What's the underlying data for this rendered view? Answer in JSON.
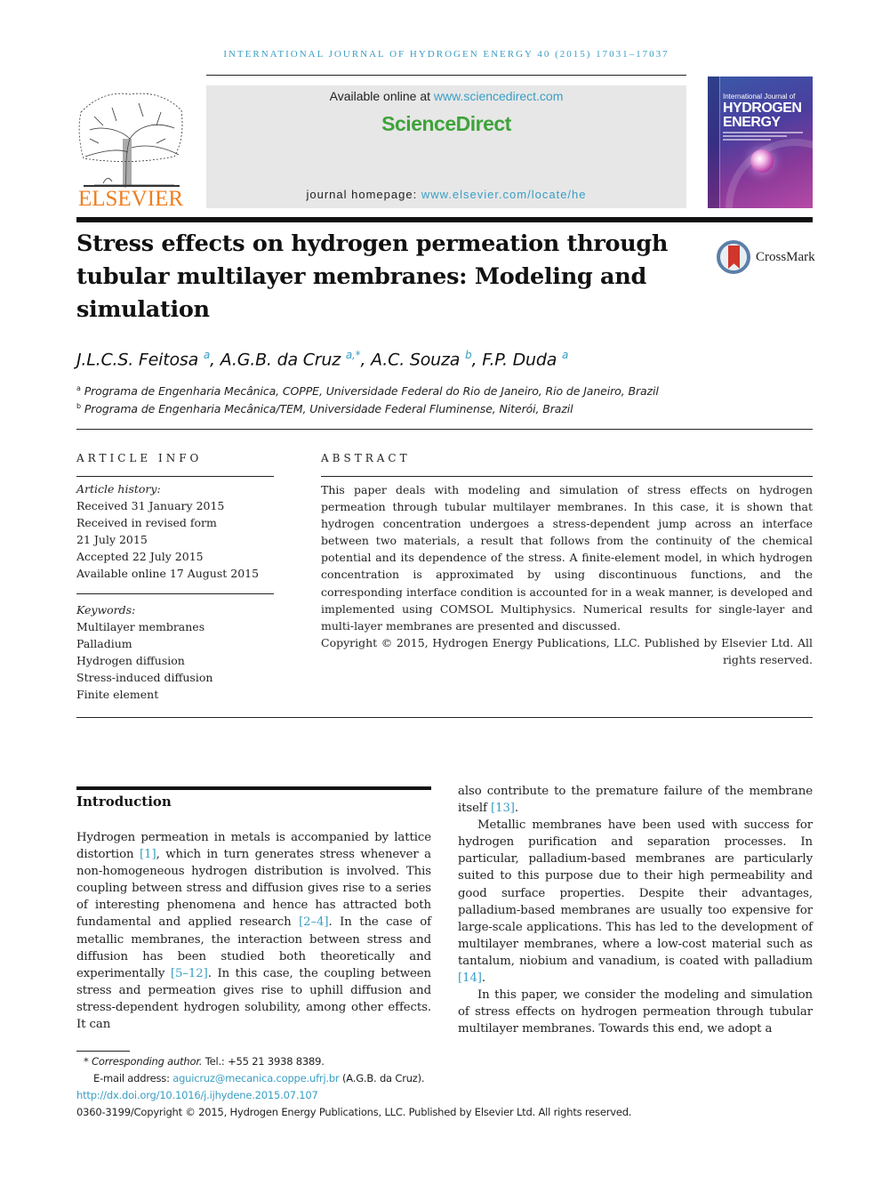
{
  "running_head": "INTERNATIONAL JOURNAL OF HYDROGEN ENERGY 40 (2015) 17031–17037",
  "publisher": {
    "logo_text": "ELSEVIER",
    "available_prefix": "Available online at ",
    "available_link": "www.sciencedirect.com",
    "brand": "ScienceDirect",
    "homepage_prefix": "journal homepage: ",
    "homepage_link": "www.elsevier.com/locate/he"
  },
  "cover": {
    "subtitle": "International Journal of",
    "title_line1": "HYDROGEN",
    "title_line2": "ENERGY"
  },
  "crossmark_label": "CrossMark",
  "title": "Stress effects on hydrogen permeation through tubular multilayer membranes: Modeling and simulation",
  "authors": [
    {
      "name": "J.L.C.S. Feitosa",
      "sup": "a"
    },
    {
      "name": "A.G.B. da Cruz",
      "sup": "a,*"
    },
    {
      "name": "A.C. Souza",
      "sup": "b"
    },
    {
      "name": "F.P. Duda",
      "sup": "a"
    }
  ],
  "affiliations": [
    {
      "mark": "a",
      "text": "Programa de Engenharia Mecânica, COPPE, Universidade Federal do Rio de Janeiro, Rio de Janeiro, Brazil"
    },
    {
      "mark": "b",
      "text": "Programa de Engenharia Mecânica/TEM, Universidade Federal Fluminense, Niterói, Brazil"
    }
  ],
  "article_info": {
    "heading": "ARTICLE INFO",
    "history_label": "Article history:",
    "history": [
      "Received 31 January 2015",
      "Received in revised form",
      "21 July 2015",
      "Accepted 22 July 2015",
      "Available online 17 August 2015"
    ],
    "keywords_label": "Keywords:",
    "keywords": [
      "Multilayer membranes",
      "Palladium",
      "Hydrogen diffusion",
      "Stress-induced diffusion",
      "Finite element"
    ]
  },
  "abstract": {
    "heading": "ABSTRACT",
    "text": "This paper deals with modeling and simulation of stress effects on hydrogen permeation through tubular multilayer membranes. In this case, it is shown that hydrogen concentration undergoes a stress-dependent jump across an interface between two materials, a result that follows from the continuity of the chemical potential and its dependence of the stress. A finite-element model, in which hydrogen concentration is approximated by using discontinuous functions, and the corresponding interface condition is accounted for in a weak manner, is developed and implemented using COMSOL Multiphysics. Numerical results for single-layer and multi-layer membranes are presented and discussed.",
    "copyright": "Copyright © 2015, Hydrogen Energy Publications, LLC. Published by Elsevier Ltd. All rights reserved."
  },
  "introduction": {
    "heading": "Introduction",
    "left_para": [
      {
        "t": "Hydrogen permeation in metals is accompanied by lattice distortion "
      },
      {
        "r": "[1]"
      },
      {
        "t": ", which in turn generates stress whenever a non-homogeneous hydrogen distribution is involved. This coupling between stress and diffusion gives rise to a series of interesting phenomena and hence has attracted both fundamental and applied research "
      },
      {
        "r": "[2–4]"
      },
      {
        "t": ". In the case of metallic membranes, the interaction between stress and diffusion has been studied both theoretically and experimentally "
      },
      {
        "r": "[5–12]"
      },
      {
        "t": ". In this case, the coupling between stress and permeation gives rise to uphill diffusion and stress-dependent hydrogen solubility, among other effects. It can"
      }
    ],
    "right_para1": [
      {
        "t": "also contribute to the premature failure of the membrane itself "
      },
      {
        "r": "[13]"
      },
      {
        "t": "."
      }
    ],
    "right_para2": [
      {
        "t": "Metallic membranes have been used with success for hydrogen purification and separation processes. In particular, palladium-based membranes are particularly suited to this purpose due to their high permeability and good surface properties. Despite their advantages, palladium-based membranes are usually too expensive for large-scale applications. This has led to the development of multilayer membranes, where a low-cost material such as tantalum, niobium and vanadium, is coated with palladium "
      },
      {
        "r": "[14]"
      },
      {
        "t": "."
      }
    ],
    "right_para3": [
      {
        "t": "In this paper, we consider the modeling and simulation of stress effects on hydrogen permeation through tubular multilayer membranes. Towards this end, we adopt a"
      }
    ]
  },
  "footnotes": {
    "star": "*",
    "corresponding_label": "Corresponding author.",
    "tel": " Tel.: +55 21 3938 8389.",
    "email_label": "E-mail address: ",
    "email": "aguicruz@mecanica.coppe.ufrj.br",
    "email_owner": " (A.G.B. da Cruz).",
    "doi": "http://dx.doi.org/10.1016/j.ijhydene.2015.07.107",
    "issn_copyright": "0360-3199/Copyright © 2015, Hydrogen Energy Publications, LLC. Published by Elsevier Ltd. All rights reserved."
  }
}
